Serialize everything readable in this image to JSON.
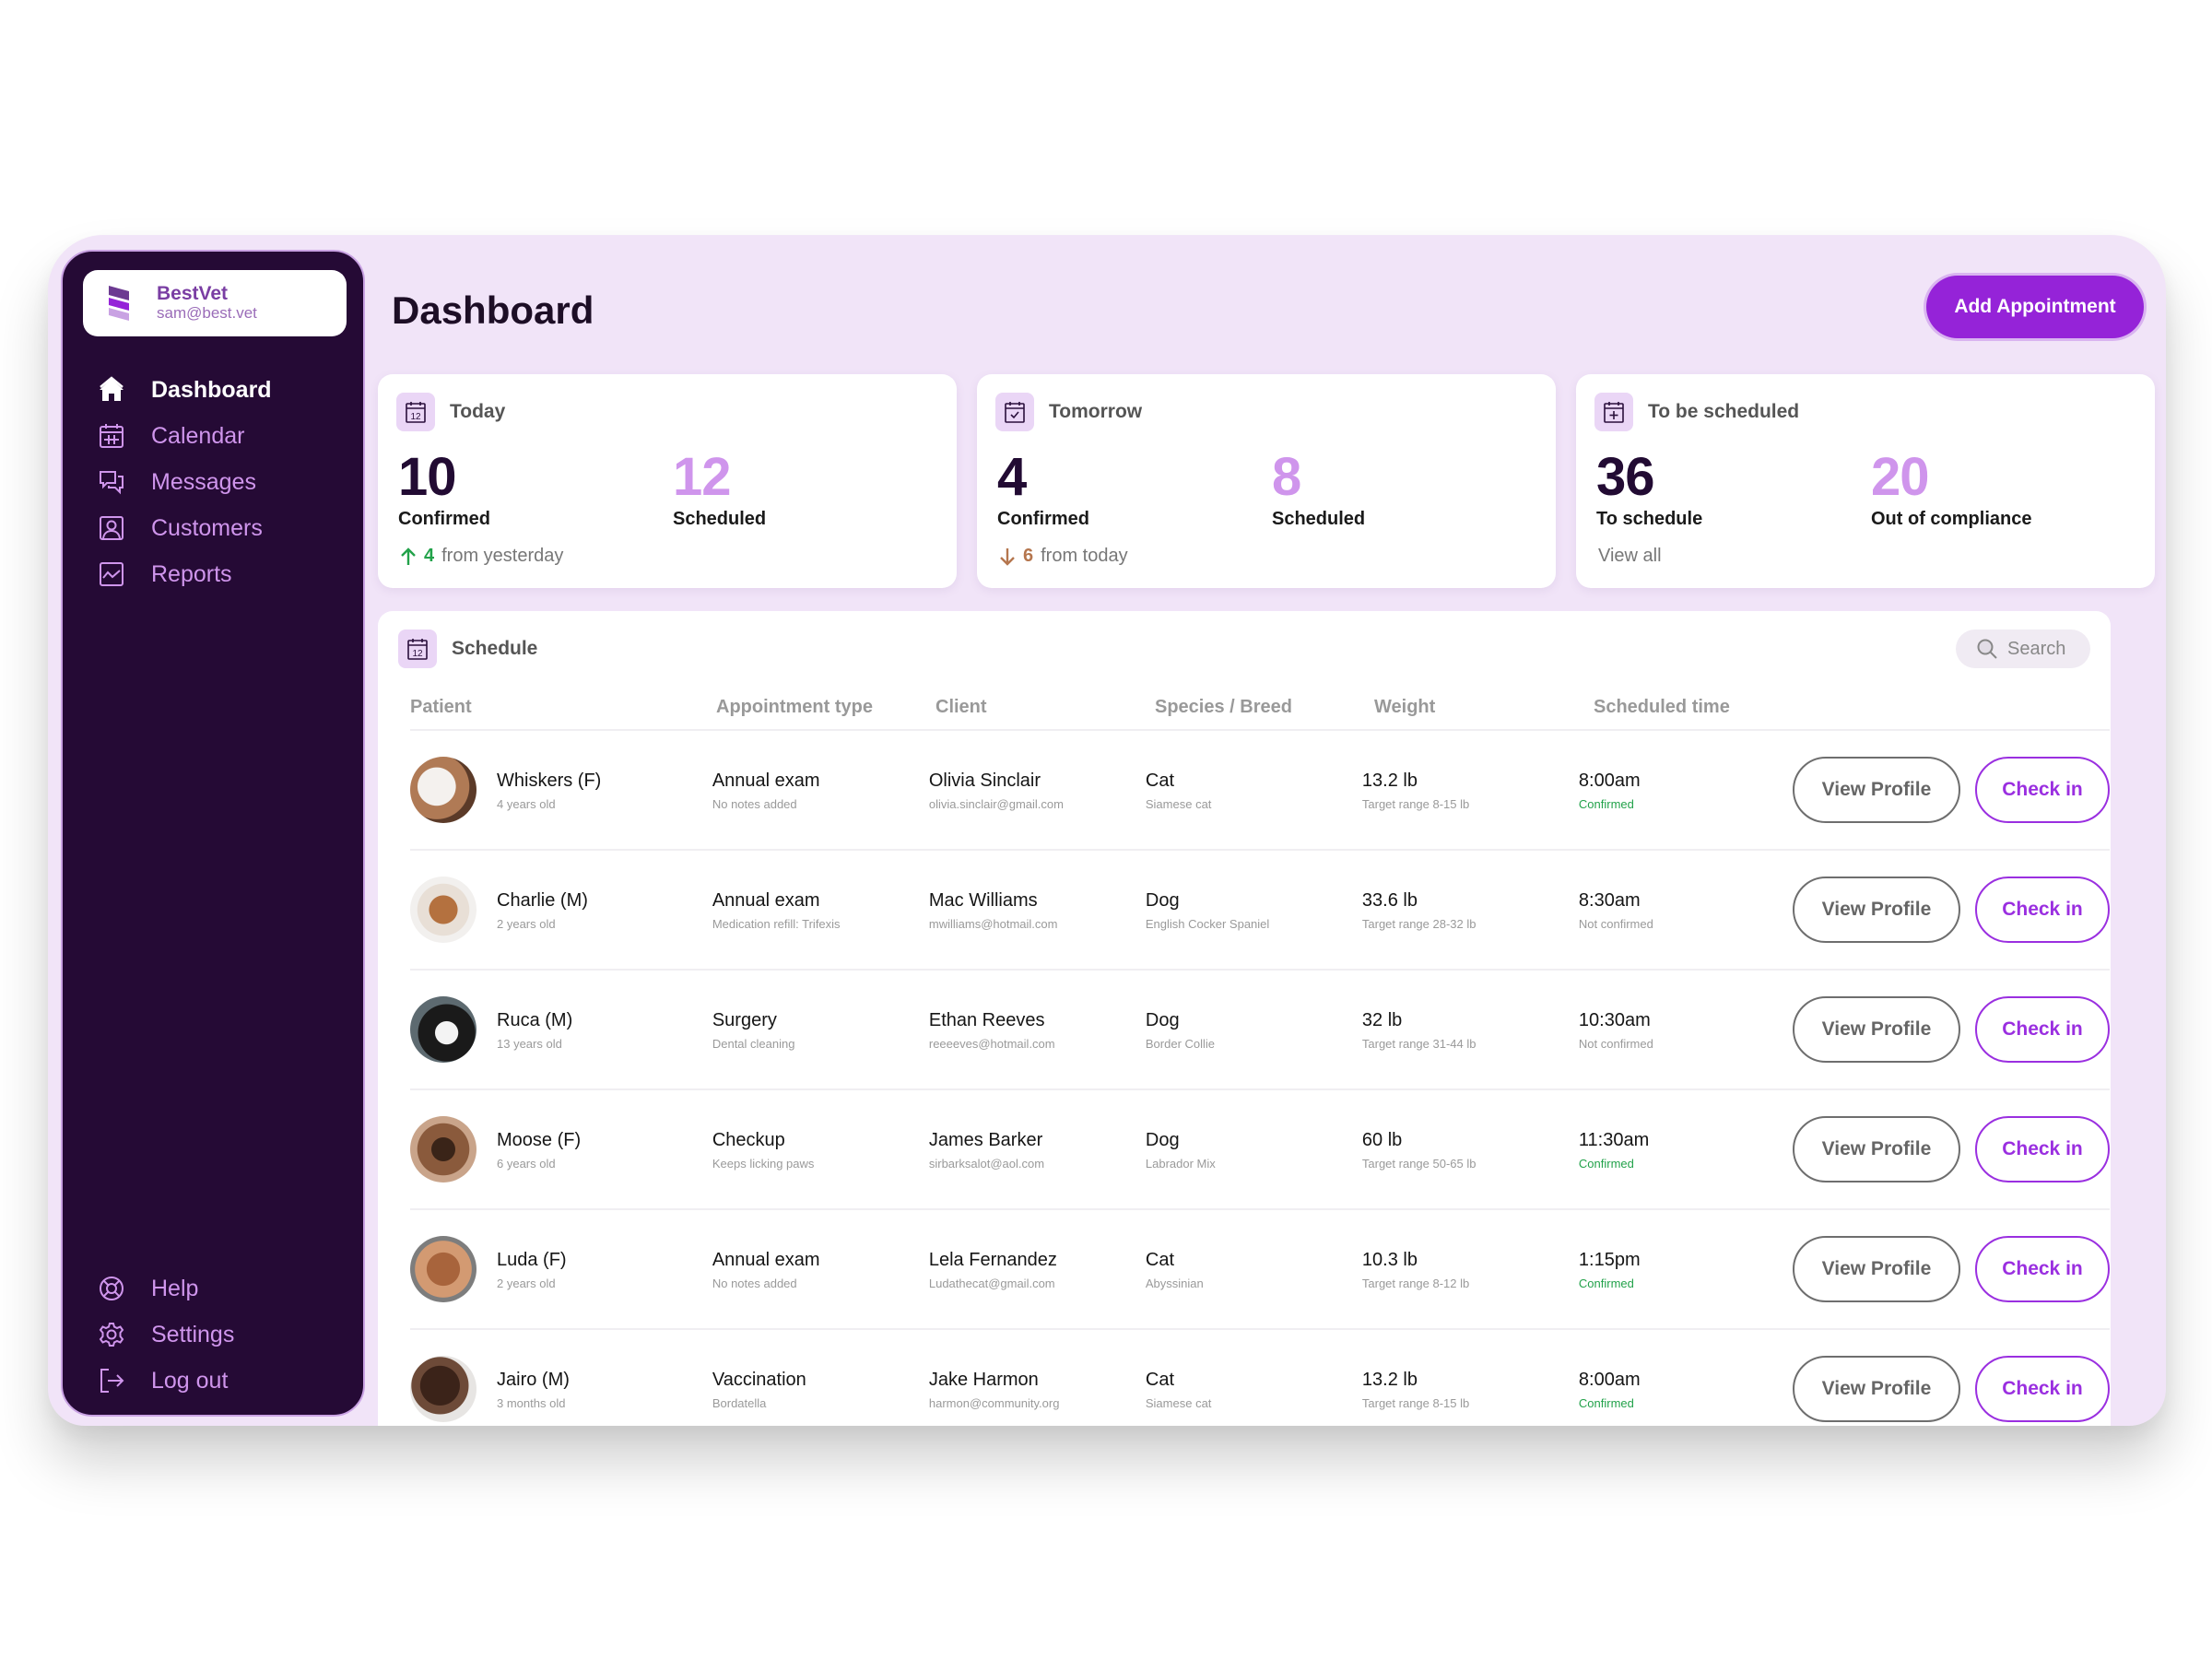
{
  "app": {
    "brand_name": "BestVet",
    "user_email": "sam@best.vet",
    "accent_color": "#9523d8",
    "sidebar_color": "#250a35"
  },
  "sidebar": {
    "items": [
      {
        "label": "Dashboard",
        "icon": "home-icon",
        "active": true
      },
      {
        "label": "Calendar",
        "icon": "calendar-icon",
        "active": false
      },
      {
        "label": "Messages",
        "icon": "chat-icon",
        "active": false
      },
      {
        "label": "Customers",
        "icon": "user-icon",
        "active": false
      },
      {
        "label": "Reports",
        "icon": "chart-icon",
        "active": false
      }
    ],
    "bottom_items": [
      {
        "label": "Help",
        "icon": "lifebuoy-icon"
      },
      {
        "label": "Settings",
        "icon": "gear-icon"
      },
      {
        "label": "Log out",
        "icon": "logout-icon"
      }
    ]
  },
  "header": {
    "title": "Dashboard",
    "add_button": "Add Appointment"
  },
  "cards": [
    {
      "title": "Today",
      "icon": "calendar-12-icon",
      "primary": {
        "value": "10",
        "label": "Confirmed"
      },
      "secondary": {
        "value": "12",
        "label": "Scheduled"
      },
      "delta": {
        "direction": "up",
        "value": "4",
        "text": "from yesterday"
      }
    },
    {
      "title": "Tomorrow",
      "icon": "calendar-check-icon",
      "primary": {
        "value": "4",
        "label": "Confirmed"
      },
      "secondary": {
        "value": "8",
        "label": "Scheduled"
      },
      "delta": {
        "direction": "down",
        "value": "6",
        "text": "from today"
      }
    },
    {
      "title": "To be scheduled",
      "icon": "calendar-plus-icon",
      "primary": {
        "value": "36",
        "label": "To schedule"
      },
      "secondary": {
        "value": "20",
        "label": "Out of compliance"
      },
      "link": "View all"
    }
  ],
  "schedule": {
    "title": "Schedule",
    "search_placeholder": "Search",
    "columns": [
      "Patient",
      "Appointment type",
      "Client",
      "Species / Breed",
      "Weight",
      "Scheduled time"
    ],
    "view_label": "View Profile",
    "checkin_label": "Check in",
    "rows": [
      {
        "patient": "Whiskers (F)",
        "age": "4 years old",
        "type": "Annual  exam",
        "note": "No notes added",
        "client": "Olivia Sinclair",
        "email": "olivia.sinclair@gmail.com",
        "species": "Cat",
        "breed": "Siamese cat",
        "weight": "13.2 lb",
        "range": "Target range 8-15 lb",
        "time": "8:00am",
        "status": "Confirmed",
        "confirmed": true
      },
      {
        "patient": "Charlie (M)",
        "age": "2 years old",
        "type": "Annual exam",
        "note": "Medication refill: Trifexis",
        "client": "Mac Williams",
        "email": "mwilliams@hotmail.com",
        "species": "Dog",
        "breed": "English Cocker Spaniel",
        "weight": "33.6 lb",
        "range": "Target range 28-32 lb",
        "time": "8:30am",
        "status": "Not confirmed",
        "confirmed": false
      },
      {
        "patient": "Ruca (M)",
        "age": "13 years old",
        "type": "Surgery",
        "note": "Dental cleaning",
        "client": "Ethan Reeves",
        "email": "reeeeves@hotmail.com",
        "species": "Dog",
        "breed": "Border Collie",
        "weight": "32 lb",
        "range": "Target range 31-44 lb",
        "time": "10:30am",
        "status": "Not confirmed",
        "confirmed": false
      },
      {
        "patient": "Moose (F)",
        "age": "6 years old",
        "type": "Checkup",
        "note": "Keeps licking paws",
        "client": "James Barker",
        "email": "sirbarksalot@aol.com",
        "species": "Dog",
        "breed": "Labrador Mix",
        "weight": "60 lb",
        "range": "Target range 50-65 lb",
        "time": "11:30am",
        "status": "Confirmed",
        "confirmed": true
      },
      {
        "patient": "Luda (F)",
        "age": "2 years old",
        "type": "Annual  exam",
        "note": "No notes added",
        "client": "Lela Fernandez",
        "email": "Ludathecat@gmail.com",
        "species": "Cat",
        "breed": "Abyssinian",
        "weight": "10.3 lb",
        "range": "Target range 8-12 lb",
        "time": "1:15pm",
        "status": "Confirmed",
        "confirmed": true
      },
      {
        "patient": "Jairo (M)",
        "age": "3 months old",
        "type": "Vaccination",
        "note": "Bordatella",
        "client": "Jake Harmon",
        "email": "harmon@community.org",
        "species": "Cat",
        "breed": "Siamese cat",
        "weight": "13.2 lb",
        "range": "Target range 8-15 lb",
        "time": "8:00am",
        "status": "Confirmed",
        "confirmed": true
      }
    ]
  }
}
